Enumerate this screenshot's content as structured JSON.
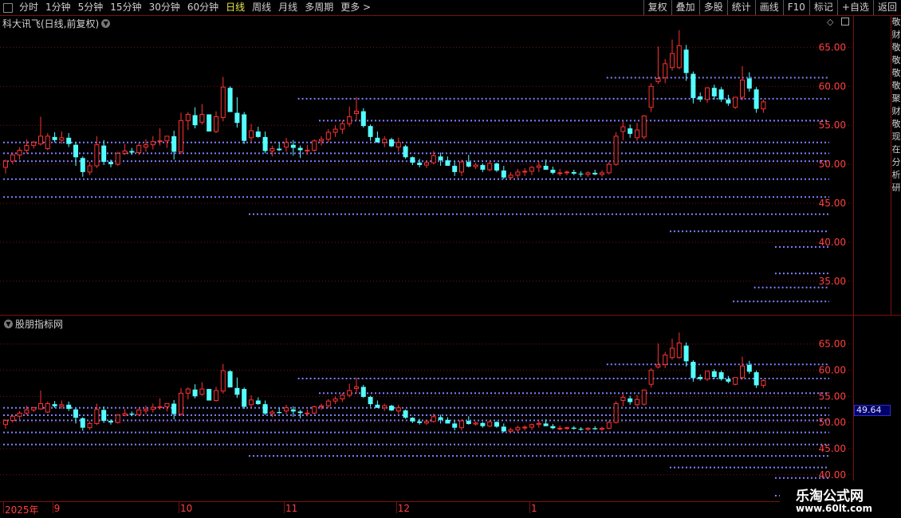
{
  "toolbar": {
    "tabs": [
      {
        "label": "分时",
        "active": false
      },
      {
        "label": "1分钟",
        "active": false
      },
      {
        "label": "5分钟",
        "active": false
      },
      {
        "label": "15分钟",
        "active": false
      },
      {
        "label": "30分钟",
        "active": false
      },
      {
        "label": "60分钟",
        "active": false
      },
      {
        "label": "日线",
        "active": true
      },
      {
        "label": "周线",
        "active": false
      },
      {
        "label": "月线",
        "active": false
      },
      {
        "label": "多周期",
        "active": false
      },
      {
        "label": "更多 >",
        "active": false
      }
    ],
    "buttons": [
      "复权",
      "叠加",
      "多股",
      "统计",
      "画线",
      "F10",
      "标记",
      "+自选",
      "返回"
    ]
  },
  "main_pane": {
    "title": "科大讯飞(日线,前复权)",
    "price_axis": [
      "65.00",
      "60.00",
      "55.00",
      "50.00",
      "45.00",
      "40.00",
      "35.00"
    ]
  },
  "sub_pane": {
    "title": "股朋指标网",
    "price_axis": [
      "65.00",
      "60.00",
      "55.00",
      "50.00",
      "45.00",
      "40.00"
    ],
    "current_value": "49.64"
  },
  "side_text": "敬财敬敬敬敬聚财敬现在分析研",
  "date_axis": {
    "labels": [
      {
        "text": "2025年",
        "bar": 0
      },
      {
        "text": "9",
        "bar": 7
      },
      {
        "text": "10",
        "bar": 25
      },
      {
        "text": "11",
        "bar": 40
      },
      {
        "text": "12",
        "bar": 56
      },
      {
        "text": "1",
        "bar": 75
      }
    ]
  },
  "watermark": {
    "line1": "乐淘公式网",
    "line2": "www.60lt.com"
  },
  "colors": {
    "up": "#ff3232",
    "down": "#54ffff",
    "level": "#8080ff",
    "grid": "#7a1010",
    "active_tab": "#e8e850"
  },
  "chart_data": {
    "type": "candlestick",
    "title": "科大讯飞(日线,前复权)",
    "ylim": [
      31,
      68
    ],
    "sub_ylim": [
      36,
      68
    ],
    "candles": [
      [
        49.6,
        50.6,
        48.8,
        50.4
      ],
      [
        50.4,
        51.5,
        50.0,
        51.2
      ],
      [
        51.2,
        52.2,
        50.6,
        51.8
      ],
      [
        51.8,
        53.2,
        51.4,
        52.4
      ],
      [
        52.4,
        53.0,
        52.0,
        52.8
      ],
      [
        52.6,
        56.1,
        52.4,
        53.6
      ],
      [
        52.0,
        54.0,
        51.8,
        53.6
      ],
      [
        53.5,
        54.1,
        52.8,
        53.1
      ],
      [
        53.1,
        54.2,
        52.6,
        53.4
      ],
      [
        53.4,
        54.0,
        52.2,
        52.6
      ],
      [
        52.5,
        52.8,
        49.8,
        50.9
      ],
      [
        50.8,
        51.0,
        48.4,
        49.0
      ],
      [
        49.0,
        50.3,
        48.6,
        49.8
      ],
      [
        49.8,
        53.6,
        49.5,
        52.5
      ],
      [
        52.4,
        53.1,
        49.9,
        50.3
      ],
      [
        50.3,
        50.6,
        49.6,
        50.0
      ],
      [
        50.0,
        51.6,
        49.8,
        51.4
      ],
      [
        51.4,
        52.6,
        51.2,
        51.7
      ],
      [
        51.7,
        52.1,
        51.2,
        51.5
      ],
      [
        51.5,
        52.7,
        51.2,
        52.4
      ],
      [
        52.2,
        53.2,
        51.6,
        52.5
      ],
      [
        52.5,
        53.6,
        51.9,
        52.9
      ],
      [
        52.9,
        54.6,
        52.4,
        53.0
      ],
      [
        53.0,
        53.6,
        52.1,
        53.6
      ],
      [
        53.6,
        54.3,
        50.6,
        51.6
      ],
      [
        51.6,
        56.6,
        51.3,
        55.6
      ],
      [
        55.6,
        56.7,
        54.4,
        56.4
      ],
      [
        56.3,
        57.3,
        54.6,
        55.0
      ],
      [
        55.4,
        57.7,
        55.1,
        56.4
      ],
      [
        56.4,
        56.4,
        55.0,
        54.2
      ],
      [
        54.2,
        56.8,
        54.0,
        56.1
      ],
      [
        56.0,
        61.2,
        55.5,
        59.9
      ],
      [
        59.8,
        60.0,
        56.7,
        56.7
      ],
      [
        56.6,
        58.6,
        54.7,
        55.3
      ],
      [
        56.4,
        56.7,
        52.6,
        53.0
      ],
      [
        53.4,
        55.2,
        52.9,
        54.3
      ],
      [
        54.2,
        54.8,
        53.4,
        53.5
      ],
      [
        53.5,
        54.2,
        51.4,
        51.7
      ],
      [
        51.7,
        52.4,
        51.0,
        52.0
      ],
      [
        52.0,
        52.8,
        51.7,
        51.8
      ],
      [
        52.2,
        53.4,
        51.6,
        52.8
      ],
      [
        52.5,
        53.1,
        51.1,
        52.1
      ],
      [
        52.1,
        52.4,
        50.8,
        51.8
      ],
      [
        51.8,
        52.5,
        51.2,
        51.8
      ],
      [
        51.8,
        53.2,
        51.6,
        53.0
      ],
      [
        53.0,
        53.6,
        52.4,
        53.2
      ],
      [
        53.2,
        54.5,
        52.8,
        54.1
      ],
      [
        54.1,
        55.0,
        53.5,
        54.5
      ],
      [
        54.5,
        55.6,
        53.9,
        55.2
      ],
      [
        55.2,
        57.4,
        54.8,
        56.1
      ],
      [
        56.5,
        58.6,
        55.6,
        56.8
      ],
      [
        56.8,
        57.2,
        54.7,
        54.9
      ],
      [
        54.9,
        55.1,
        53.0,
        53.5
      ],
      [
        53.4,
        54.2,
        52.8,
        52.8
      ],
      [
        52.8,
        53.6,
        52.2,
        53.2
      ],
      [
        53.2,
        53.4,
        52.2,
        52.3
      ],
      [
        52.2,
        53.4,
        51.6,
        52.8
      ],
      [
        52.3,
        52.5,
        50.7,
        50.9
      ],
      [
        50.9,
        51.0,
        49.9,
        50.2
      ],
      [
        50.2,
        50.7,
        49.6,
        49.9
      ],
      [
        49.9,
        50.5,
        49.5,
        50.2
      ],
      [
        50.2,
        51.7,
        50.0,
        51.1
      ],
      [
        51.0,
        51.5,
        49.8,
        50.5
      ],
      [
        50.5,
        51.0,
        49.9,
        49.8
      ],
      [
        49.8,
        50.4,
        48.5,
        49.0
      ],
      [
        49.0,
        50.6,
        48.5,
        50.3
      ],
      [
        50.3,
        51.2,
        49.6,
        49.7
      ],
      [
        49.7,
        50.2,
        49.4,
        49.9
      ],
      [
        49.9,
        50.1,
        49.0,
        49.3
      ],
      [
        49.3,
        50.4,
        49.1,
        50.1
      ],
      [
        50.1,
        50.2,
        49.0,
        49.2
      ],
      [
        49.2,
        49.8,
        48.1,
        48.3
      ],
      [
        48.3,
        49.0,
        48.0,
        48.6
      ],
      [
        48.6,
        49.4,
        48.2,
        49.0
      ],
      [
        49.0,
        49.5,
        48.5,
        49.1
      ],
      [
        49.1,
        49.8,
        48.6,
        49.6
      ],
      [
        49.6,
        50.4,
        49.0,
        49.8
      ],
      [
        49.8,
        50.6,
        49.3,
        49.3
      ],
      [
        49.3,
        49.7,
        48.7,
        48.9
      ],
      [
        48.9,
        49.4,
        48.5,
        48.9
      ],
      [
        48.9,
        49.2,
        48.6,
        49.0
      ],
      [
        49.0,
        49.3,
        48.6,
        48.8
      ],
      [
        48.8,
        49.1,
        48.4,
        48.7
      ],
      [
        48.7,
        49.1,
        48.4,
        48.9
      ],
      [
        48.9,
        49.3,
        48.6,
        48.7
      ],
      [
        48.7,
        49.2,
        48.4,
        48.9
      ],
      [
        48.9,
        50.3,
        48.7,
        50.0
      ],
      [
        50.0,
        54.1,
        49.8,
        53.6
      ],
      [
        54.2,
        55.5,
        53.1,
        54.8
      ],
      [
        54.6,
        55.1,
        53.4,
        53.9
      ],
      [
        53.4,
        55.3,
        53.0,
        54.4
      ],
      [
        53.5,
        56.3,
        53.2,
        56.2
      ],
      [
        57.3,
        60.4,
        56.7,
        60.0
      ],
      [
        60.6,
        65.1,
        60.3,
        61.0
      ],
      [
        61.1,
        63.5,
        60.4,
        62.9
      ],
      [
        62.4,
        66.0,
        62.0,
        64.2
      ],
      [
        62.4,
        67.2,
        62.2,
        65.2
      ],
      [
        64.7,
        65.3,
        60.7,
        61.7
      ],
      [
        61.6,
        61.9,
        57.8,
        58.5
      ],
      [
        58.7,
        59.2,
        58.0,
        58.3
      ],
      [
        58.3,
        59.9,
        57.9,
        59.8
      ],
      [
        59.8,
        60.2,
        58.3,
        58.7
      ],
      [
        59.6,
        59.9,
        58.0,
        58.3
      ],
      [
        58.3,
        58.9,
        57.5,
        57.8
      ],
      [
        57.3,
        58.5,
        57.1,
        58.6
      ],
      [
        58.6,
        62.6,
        58.2,
        60.8
      ],
      [
        61.0,
        61.8,
        59.3,
        59.7
      ],
      [
        59.6,
        59.9,
        56.6,
        57.1
      ],
      [
        57.1,
        58.3,
        56.6,
        58.0
      ]
    ],
    "levels": [
      {
        "price": 61.1,
        "from": 86
      },
      {
        "price": 58.4,
        "from": 42
      },
      {
        "price": 55.6,
        "from": 45
      },
      {
        "price": 52.8,
        "from": 0
      },
      {
        "price": 51.4,
        "from": 0
      },
      {
        "price": 50.4,
        "from": 0
      },
      {
        "price": 48.1,
        "from": 0
      },
      {
        "price": 45.8,
        "from": 0
      },
      {
        "price": 43.6,
        "from": 35
      },
      {
        "price": 41.4,
        "from": 95
      },
      {
        "price": 39.4,
        "from": 110
      },
      {
        "price": 36.0,
        "from": 110
      },
      {
        "price": 34.2,
        "from": 107
      },
      {
        "price": 32.4,
        "from": 104
      }
    ]
  }
}
